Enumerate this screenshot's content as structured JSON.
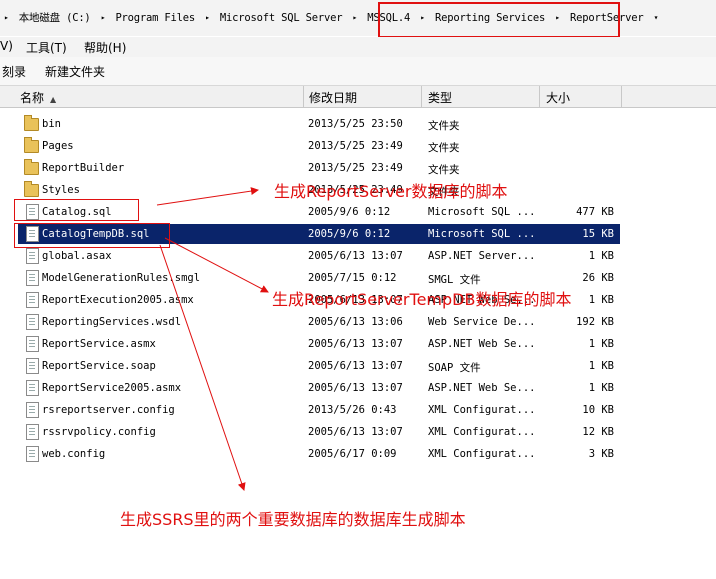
{
  "address_bar": {
    "crumbs": [
      "本地磁盘 (C:)",
      "Program Files",
      "Microsoft SQL Server",
      "MSSQL.4",
      "Reporting Services",
      "ReportServer"
    ]
  },
  "menubar": {
    "view_fragment": "V)",
    "tools": "工具(T)",
    "help": "帮助(H)"
  },
  "toolbar": {
    "burn": "刻录",
    "new_folder": "新建文件夹"
  },
  "columns": {
    "name": "名称",
    "modified": "修改日期",
    "type": "类型",
    "size": "大小"
  },
  "files": [
    {
      "name": "bin",
      "date": "2013/5/25 23:50",
      "type": "文件夹",
      "size": "",
      "icon": "folder-icon"
    },
    {
      "name": "Pages",
      "date": "2013/5/25 23:49",
      "type": "文件夹",
      "size": "",
      "icon": "folder-icon"
    },
    {
      "name": "ReportBuilder",
      "date": "2013/5/25 23:49",
      "type": "文件夹",
      "size": "",
      "icon": "folder-icon"
    },
    {
      "name": "Styles",
      "date": "2013/5/25 23:49",
      "type": "文件夹",
      "size": "",
      "icon": "folder-icon"
    },
    {
      "name": "Catalog.sql",
      "date": "2005/9/6 0:12",
      "type": "Microsoft SQL ...",
      "size": "477 KB",
      "icon": "sql-file-icon"
    },
    {
      "name": "CatalogTempDB.sql",
      "date": "2005/9/6 0:12",
      "type": "Microsoft SQL ...",
      "size": "15 KB",
      "icon": "sql-file-icon",
      "selected": true
    },
    {
      "name": "global.asax",
      "date": "2005/6/13 13:07",
      "type": "ASP.NET Server...",
      "size": "1 KB",
      "icon": "asax-file-icon"
    },
    {
      "name": "ModelGenerationRules.smgl",
      "date": "2005/7/15 0:12",
      "type": "SMGL 文件",
      "size": "26 KB",
      "icon": "file-icon"
    },
    {
      "name": "ReportExecution2005.asmx",
      "date": "2005/6/13 13:07",
      "type": "ASP.NET Web Se...",
      "size": "1 KB",
      "icon": "asmx-file-icon"
    },
    {
      "name": "ReportingServices.wsdl",
      "date": "2005/6/13 13:06",
      "type": "Web Service De...",
      "size": "192 KB",
      "icon": "wsdl-file-icon"
    },
    {
      "name": "ReportService.asmx",
      "date": "2005/6/13 13:07",
      "type": "ASP.NET Web Se...",
      "size": "1 KB",
      "icon": "asmx-file-icon"
    },
    {
      "name": "ReportService.soap",
      "date": "2005/6/13 13:07",
      "type": "SOAP 文件",
      "size": "1 KB",
      "icon": "file-icon"
    },
    {
      "name": "ReportService2005.asmx",
      "date": "2005/6/13 13:07",
      "type": "ASP.NET Web Se...",
      "size": "1 KB",
      "icon": "asmx-file-icon"
    },
    {
      "name": "rsreportserver.config",
      "date": "2013/5/26 0:43",
      "type": "XML Configurat...",
      "size": "10 KB",
      "icon": "config-file-icon"
    },
    {
      "name": "rssrvpolicy.config",
      "date": "2005/6/13 13:07",
      "type": "XML Configurat...",
      "size": "12 KB",
      "icon": "config-file-icon"
    },
    {
      "name": "web.config",
      "date": "2005/6/17 0:09",
      "type": "XML Configurat...",
      "size": "3 KB",
      "icon": "config-file-icon"
    }
  ],
  "annotations": {
    "catalog_note": "生成ReportServer数据库的脚本",
    "tempdb_note": "生成ReportServerTempDB数据库的脚本",
    "summary_note": "生成SSRS里的两个重要数据库的数据库生成脚本",
    "color": "#e01010"
  },
  "colors": {
    "selection": "#0a246a",
    "annotation": "#e01010"
  }
}
